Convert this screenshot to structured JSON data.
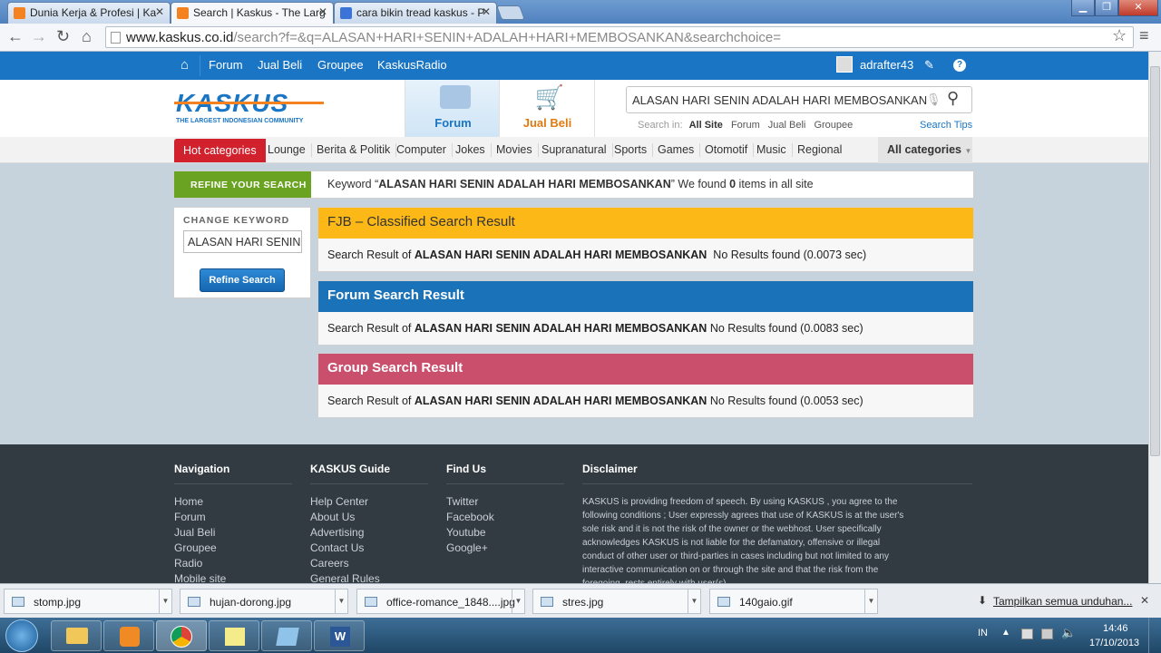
{
  "browser": {
    "tabs": [
      {
        "label": "Dunia Kerja & Profesi | Ka",
        "active": false
      },
      {
        "label": "Search | Kaskus - The Larg",
        "active": true
      },
      {
        "label": "cara bikin tread kaskus - P",
        "active": false
      }
    ],
    "url_host": "www.kaskus.co.id",
    "url_path": "/search?f=&q=ALASAN+HARI+SENIN+ADALAH+HARI+MEMBOSANKAN&searchchoice="
  },
  "site": {
    "topnav": [
      "Forum",
      "Jual Beli",
      "Groupee",
      "KaskusRadio"
    ],
    "username": "adrafter43",
    "logo_text": "KASKUS",
    "logo_tagline": "THE LARGEST INDONESIAN COMMUNITY",
    "header_tabs": [
      {
        "label": "Forum"
      },
      {
        "label": "Jual Beli"
      }
    ],
    "search": {
      "value": "ALASAN HARI SENIN ADALAH HARI MEMBOSANKAN",
      "search_in_label": "Search in:",
      "options": [
        "All Site",
        "Forum",
        "Jual Beli",
        "Groupee"
      ],
      "tips": "Search Tips"
    },
    "categories": [
      "Hot categories",
      "Lounge",
      "Berita & Politik",
      "Computer",
      "Jokes",
      "Movies",
      "Supranatural",
      "Sports",
      "Games",
      "Otomotif",
      "Music",
      "Regional"
    ],
    "all_categories": "All categories"
  },
  "refine": {
    "label": "REFINE YOUR SEARCH",
    "keyword_prefix": "Keyword “",
    "keyword": "ALASAN HARI SENIN ADALAH HARI MEMBOSANKAN",
    "keyword_suffix": "” We found ",
    "count": "0",
    "count_suffix": " items in all site",
    "change_label": "CHANGE KEYWORD",
    "input_value": "ALASAN HARI SENIN",
    "button": "Refine Search"
  },
  "results": [
    {
      "title": "FJB – Classified Search Result",
      "prefix": "Search Result of ",
      "keyword": "ALASAN HARI SENIN ADALAH HARI MEMBOSANKAN",
      "status": "  No Results found (0.0073 sec)",
      "color": "#fbb817"
    },
    {
      "title": "Forum Search Result",
      "prefix": "Search Result of ",
      "keyword": "ALASAN HARI SENIN ADALAH HARI MEMBOSANKAN",
      "status": " No Results found (0.0083 sec)",
      "color": "#1a72b8"
    },
    {
      "title": "Group Search Result",
      "prefix": "Search Result of ",
      "keyword": "ALASAN HARI SENIN ADALAH HARI MEMBOSANKAN",
      "status": " No Results found (0.0053 sec)",
      "color": "#c94f6d"
    }
  ],
  "footer": {
    "navigation": {
      "title": "Navigation",
      "links": [
        "Home",
        "Forum",
        "Jual Beli",
        "Groupee",
        "Radio",
        "Mobile site"
      ]
    },
    "guide": {
      "title": "KASKUS Guide",
      "links": [
        "Help Center",
        "About Us",
        "Advertising",
        "Contact Us",
        "Careers",
        "General Rules"
      ]
    },
    "findus": {
      "title": "Find Us",
      "links": [
        "Twitter",
        "Facebook",
        "Youtube",
        "Google+"
      ]
    },
    "disclaimer": {
      "title": "Disclaimer",
      "text": "KASKUS is providing freedom of speech. By using KASKUS , you agree to the following conditions ; User expressly agrees that use of KASKUS is at the user's sole risk and it is not the risk of the owner or the webhost. User specifically acknowledges KASKUS is not liable for the defamatory, offensive or illegal conduct of other user or third-parties in cases including but not limited to any interactive communication on or through the site and that the risk from the foregoing, rests entirely with user(s)."
    }
  },
  "downloads": {
    "items": [
      "stomp.jpg",
      "hujan-dorong.jpg",
      "office-romance_1848....jpg",
      "stres.jpg",
      "140gaio.gif"
    ],
    "show_all": "Tampilkan semua unduhan..."
  },
  "taskbar": {
    "lang": "IN",
    "time": "14:46",
    "date": "17/10/2013"
  }
}
